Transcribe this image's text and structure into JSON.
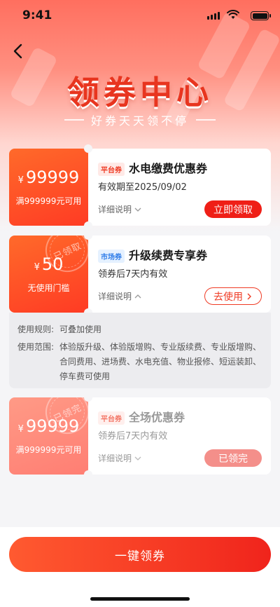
{
  "status_bar": {
    "time": "9:41"
  },
  "header": {
    "title": "领券中心",
    "subtitle": "好券天天领不停"
  },
  "coupons": [
    {
      "amount": "99999",
      "currency": "¥",
      "condition": "满999999元可用",
      "tag": "平台券",
      "name": "水电缴费优惠券",
      "validity": "有效期至2025/09/02",
      "detail_label": "详细说明",
      "action": "立即领取",
      "state": "available"
    },
    {
      "amount": "50",
      "currency": "¥",
      "condition": "无使用门槛",
      "tag": "市场券",
      "name": "升级续费专享券",
      "validity": "领券后7天内有效",
      "detail_label": "详细说明",
      "action": "去使用",
      "stamp": "已领取",
      "state": "claimed",
      "rules": [
        {
          "label": "使用规则:",
          "text": "可叠加使用"
        },
        {
          "label": "使用范围:",
          "text": "体验版升级、体验版增购、专业版续费、专业版增购、合同费用、进场费、水电充值、物业报修、短运装卸、停车费可使用"
        }
      ]
    },
    {
      "amount": "99999",
      "currency": "¥",
      "condition": "满999999元可用",
      "tag": "平台券",
      "name": "全场优惠券",
      "validity": "领券后7天内有效",
      "detail_label": "详细说明",
      "action": "已领完",
      "stamp": "已领完",
      "state": "sold-out"
    }
  ],
  "footer": {
    "button_label": "一键领券"
  },
  "colors": {
    "accent": "#ef1f17",
    "market_tag": "#2f7de9"
  }
}
